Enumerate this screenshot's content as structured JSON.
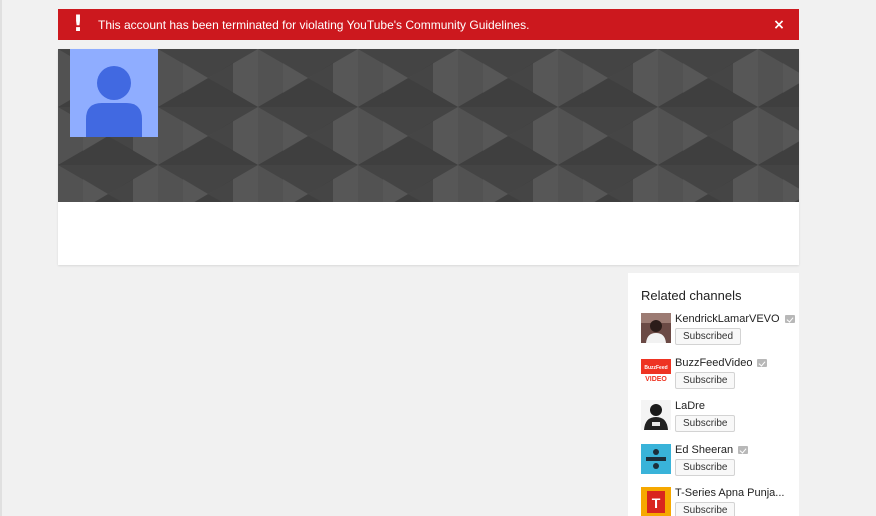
{
  "alert": {
    "message": "This account has been terminated for violating YouTube's Community Guidelines.",
    "icon": "exclamation-icon",
    "close_glyph": "×",
    "color": "#cc181e"
  },
  "channel": {
    "banner_color": "#4a4a4a",
    "avatar_color": "#8fadff",
    "avatar_figure_color": "#4169e1"
  },
  "related": {
    "title": "Related channels",
    "channels": [
      {
        "name": "KendrickLamarVEVO",
        "button": "Subscribed",
        "verified": true
      },
      {
        "name": "BuzzFeedVideo",
        "button": "Subscribe",
        "verified": true,
        "thumb_text_top": "BuzzFeed",
        "thumb_text_bottom": "VIDEO"
      },
      {
        "name": "LaDre",
        "button": "Subscribe",
        "verified": false
      },
      {
        "name": "Ed Sheeran",
        "button": "Subscribe",
        "verified": true,
        "thumb_glyph": "÷"
      },
      {
        "name": "T-Series Apna Punja...",
        "button": "Subscribe",
        "verified": false,
        "thumb_glyph": "T"
      }
    ]
  }
}
